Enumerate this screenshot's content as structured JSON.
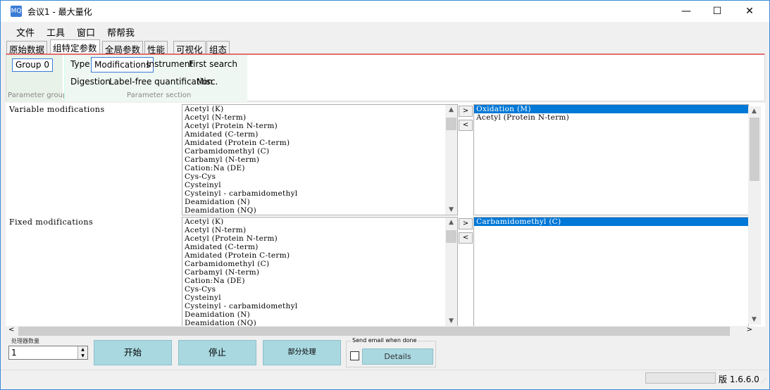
{
  "window": {
    "title": "会议1 - 最大量化",
    "icon": "mq-app-icon",
    "minimize": "—",
    "maximize": "☐",
    "close": "✕"
  },
  "menu": [
    "文件",
    "工具",
    "窗口",
    "帮帮我"
  ],
  "tabs": [
    {
      "label": "原始数据",
      "active": false
    },
    {
      "label": "组特定参数",
      "active": true
    },
    {
      "label": "全局参数",
      "active": false
    },
    {
      "label": "性能",
      "active": false
    },
    {
      "label": "可视化",
      "active": false
    },
    {
      "label": "组态",
      "active": false
    }
  ],
  "parameter_group": {
    "button": "Group 0",
    "caption": "Parameter group"
  },
  "parameter_section": {
    "row1": [
      "Type",
      "Modifications",
      "Instrument",
      "First search"
    ],
    "row2": [
      "Digestion",
      "Label-free quantification",
      "Misc."
    ],
    "active": "Modifications",
    "caption": "Parameter section"
  },
  "variable_modifications": {
    "label": "Variable modifications",
    "available": [
      "Acetyl (K)",
      "Acetyl (N-term)",
      "Acetyl (Protein N-term)",
      "Amidated (C-term)",
      "Amidated (Protein C-term)",
      "Carbamidomethyl (C)",
      "Carbamyl (N-term)",
      "Cation:Na (DE)",
      "Cys-Cys",
      "Cysteinyl",
      "Cysteinyl - carbamidomethyl",
      "Deamidation (N)",
      "Deamidation (NQ)"
    ],
    "selected": [
      "Oxidation (M)",
      "Acetyl (Protein N-term)"
    ],
    "highlighted": "Oxidation (M)"
  },
  "fixed_modifications": {
    "label": "Fixed modifications",
    "available": [
      "Acetyl (K)",
      "Acetyl (N-term)",
      "Acetyl (Protein N-term)",
      "Amidated (C-term)",
      "Amidated (Protein C-term)",
      "Carbamidomethyl (C)",
      "Carbamyl (N-term)",
      "Cation:Na (DE)",
      "Cys-Cys",
      "Cysteinyl",
      "Cysteinyl - carbamidomethyl",
      "Deamidation (N)",
      "Deamidation (NQ)"
    ],
    "selected": [
      "Carbamidomethyl (C)"
    ],
    "highlighted": "Carbamidomethyl (C)"
  },
  "move_buttons": {
    "add": ">",
    "remove": "<"
  },
  "bottom": {
    "threads_caption": "处理器数量",
    "threads_value": "1",
    "start": "开始",
    "stop": "停止",
    "partial": "部分处理",
    "email_caption": "Send email when done",
    "details": "Details"
  },
  "status": {
    "version": "版 1.6.6.0"
  },
  "colors": {
    "accent": "#0078d7",
    "action_button": "#a9d8e0",
    "tab_border_highlight": "#e07070"
  }
}
